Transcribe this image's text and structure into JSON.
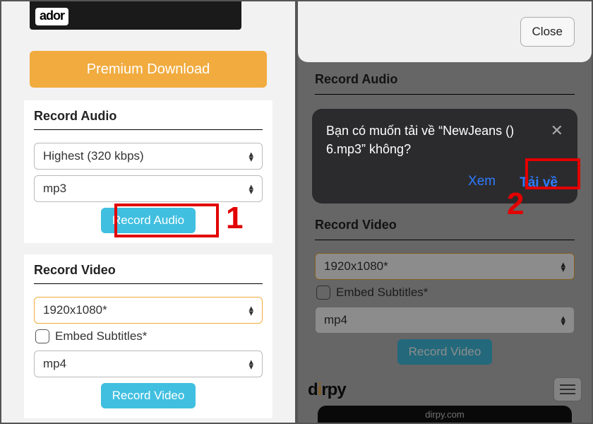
{
  "left": {
    "logo": "ador",
    "premium_button": "Premium Download",
    "record_audio": {
      "title": "Record Audio",
      "quality": "Highest (320 kbps)",
      "format": "mp3",
      "action": "Record Audio"
    },
    "record_video": {
      "title": "Record Video",
      "resolution": "1920x1080*",
      "embed_label": "Embed Subtitles*",
      "format": "mp4",
      "action": "Record Video"
    },
    "step_number": "1"
  },
  "right": {
    "close": "Close",
    "bg": {
      "record_audio_title": "Record Audio",
      "record_video_title": "Record Video",
      "resolution": "1920x1080*",
      "embed_label": "Embed Subtitles*",
      "format": "mp4",
      "action": "Record Video"
    },
    "modal": {
      "message": "Bạn có muốn tải về “NewJeans () 6.mp3” không?",
      "view": "Xem",
      "download": "Tải về"
    },
    "step_number": "2",
    "brand": "dirpy",
    "url": "dirpy.com"
  },
  "colors": {
    "accent_orange": "#f1ab3f",
    "accent_cyan": "#40bfe0",
    "highlight_red": "#e20000",
    "link_blue": "#2f7bff"
  }
}
